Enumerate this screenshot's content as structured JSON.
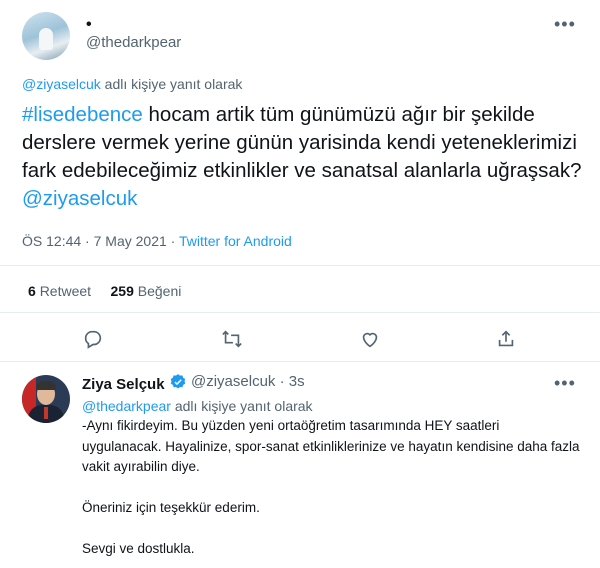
{
  "tweet": {
    "display_name": "•",
    "handle": "@thedarkpear",
    "more_icon": "more-horizontal-icon",
    "reply_mention": "@ziyaselcuk",
    "reply_suffix": " adlı kişiye yanıt olarak",
    "hashtag": "#lisedebence",
    "text_body": " hocam artik tüm günümüzü ağır bir şekilde derslere vermek yerine günün yarisinda kendi yeteneklerimizi fark edebileceğimiz etkinlikler ve sanatsal alanlarla uğraşsak? ",
    "text_mention": "@ziyaselcuk",
    "time": "ÖS 12:44",
    "date": "7 May 2021",
    "source": "Twitter for Android",
    "separator": " · ",
    "retweet_count": "6",
    "retweet_label": "Retweet",
    "like_count": "259",
    "like_label": "Beğeni"
  },
  "actions": {
    "reply_icon": "reply-icon",
    "retweet_icon": "retweet-icon",
    "like_icon": "heart-icon",
    "share_icon": "share-icon"
  },
  "reply": {
    "display_name": "Ziya Selçuk",
    "verified_icon": "verified-badge-icon",
    "handle": "@ziyaselcuk",
    "time_sep": "·",
    "time": "3s",
    "reply_mention": "@thedarkpear",
    "reply_suffix": " adlı kişiye yanıt olarak",
    "text": "-Aynı fikirdeyim. Bu yüzden yeni ortaöğretim tasarımında HEY saatleri uygulanacak. Hayalinize, spor-sanat etkinliklerinize ve hayatın kendisine daha fazla vakit ayırabilin diye.\n\nÖneriniz için teşekkür ederim.\n\nSevgi ve dostlukla."
  },
  "colors": {
    "accent": "#1d9bf0",
    "text": "#0f1419",
    "muted": "#536471"
  }
}
